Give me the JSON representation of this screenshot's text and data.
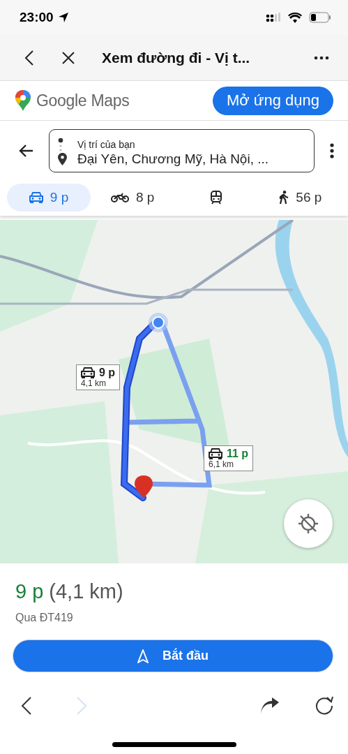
{
  "status_bar": {
    "time": "23:00"
  },
  "browser_bar": {
    "title": "Xem đường đi - Vị t..."
  },
  "maps_header": {
    "logo_text": "Google Maps",
    "open_app_button": "Mở ứng dụng"
  },
  "route": {
    "origin": "Vị trí của bạn",
    "destination": "Đại Yên, Chương Mỹ, Hà Nội, ..."
  },
  "modes": [
    {
      "kind": "car",
      "label": "9 p",
      "selected": true
    },
    {
      "kind": "motorbike",
      "label": "8 p",
      "selected": false
    },
    {
      "kind": "transit",
      "selected": false
    },
    {
      "kind": "walk",
      "label": "56 p",
      "selected": false
    }
  ],
  "map": {
    "kind": "picture",
    "callouts": [
      {
        "time": "9 p",
        "distance": "4,1 km",
        "selected": true
      },
      {
        "time": "11 p",
        "distance": "6,1 km",
        "selected": false
      }
    ]
  },
  "summary": {
    "time": "9 p",
    "distance": "(4,1 km)",
    "via": "Qua ĐT419",
    "start_button": "Bắt đầu"
  },
  "toolbar": [
    {
      "kind": "back",
      "disabled": false
    },
    {
      "kind": "forward",
      "disabled": true
    },
    {
      "kind": "share",
      "disabled": false
    },
    {
      "kind": "reload",
      "disabled": false
    }
  ]
}
